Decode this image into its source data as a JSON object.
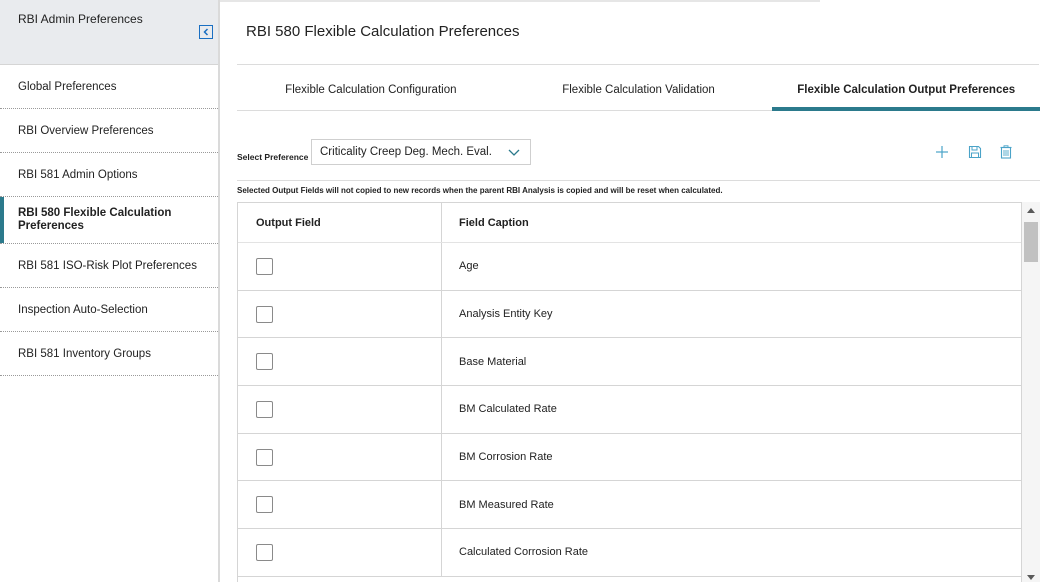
{
  "sidebar": {
    "title": "RBI Admin Preferences",
    "items": [
      {
        "label": "Global Preferences"
      },
      {
        "label": "RBI Overview Preferences"
      },
      {
        "label": "RBI 581 Admin Options"
      },
      {
        "label": "RBI 580 Flexible Calculation Preferences",
        "active": true
      },
      {
        "label": "RBI 581 ISO-Risk Plot Preferences"
      },
      {
        "label": "Inspection Auto-Selection"
      },
      {
        "label": "RBI 581 Inventory Groups"
      }
    ]
  },
  "main": {
    "title": "RBI 580 Flexible Calculation Preferences",
    "tabs": [
      {
        "label": "Flexible Calculation Configuration"
      },
      {
        "label": "Flexible Calculation Validation"
      },
      {
        "label": "Flexible Calculation Output Preferences",
        "active": true
      }
    ],
    "preference": {
      "label": "Select Preference",
      "selected": "Criticality Creep Deg. Mech. Eval."
    },
    "toolbar": {
      "add_icon": "plus-icon",
      "save_icon": "save-icon",
      "delete_icon": "trash-icon"
    },
    "note": "Selected Output Fields will not copied to new records when the parent RBI Analysis is copied and will be reset when calculated.",
    "grid": {
      "columns": [
        "Output Field",
        "Field Caption"
      ],
      "rows": [
        {
          "checked": false,
          "caption": "Age"
        },
        {
          "checked": false,
          "caption": "Analysis Entity Key"
        },
        {
          "checked": false,
          "caption": "Base Material"
        },
        {
          "checked": false,
          "caption": "BM Calculated Rate"
        },
        {
          "checked": false,
          "caption": "BM Corrosion Rate"
        },
        {
          "checked": false,
          "caption": "BM Measured Rate"
        },
        {
          "checked": false,
          "caption": "Calculated Corrosion Rate"
        }
      ]
    }
  },
  "colors": {
    "accent": "#2b7a8c",
    "collapse_button": "#1a6fc2",
    "toolbar_icon": "#4aa3c8"
  }
}
